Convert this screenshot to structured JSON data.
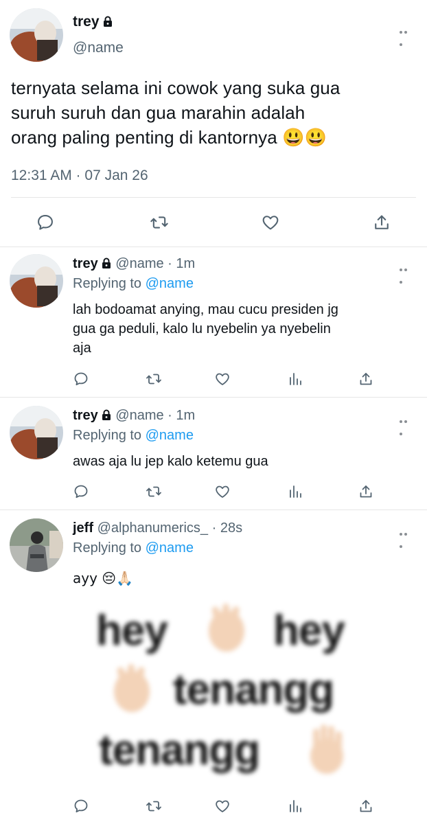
{
  "main_tweet": {
    "author_name": "trey",
    "handle": "@name",
    "text_lines": [
      "ternyata selama ini cowok yang suka gua",
      "suruh suruh dan gua marahin adalah",
      "orang paling penting di kantornya 😃😃"
    ],
    "timestamp": "12:31 AM · 07 Jan 26"
  },
  "replies": [
    {
      "author_name": "trey",
      "handle": "@name",
      "time": "· 1m",
      "replying_prefix": "Replying to",
      "replying_to": "@name",
      "text_lines": [
        "lah bodoamat anying, mau cucu presiden jg",
        "gua ga peduli, kalo lu nyebelin ya nyebelin",
        "aja"
      ]
    },
    {
      "author_name": "trey",
      "handle": "@name",
      "time": "· 1m",
      "replying_prefix": "Replying to",
      "replying_to": "@name",
      "text_lines": [
        "awas aja lu jep kalo ketemu gua"
      ]
    },
    {
      "author_name": "jeff",
      "handle": "@alphanumerics_",
      "time": "· 28s",
      "replying_prefix": "Replying to",
      "replying_to": "@name",
      "text_lines": [
        "ayy 😔🙏🏻"
      ],
      "meme": {
        "line1": [
          "hey",
          "hey"
        ],
        "line2": "tenangg",
        "line3": "tenangg"
      }
    }
  ],
  "icons": {
    "reply": "comment-bubble-icon",
    "retweet": "retweet-icon",
    "like": "heart-icon",
    "views": "analytics-icon",
    "share": "share-upload-icon",
    "lock": "lock-icon",
    "more": "more-dots-icon"
  },
  "colors": {
    "link": "#1d9bf0",
    "muted": "#536471",
    "text": "#0f1419"
  }
}
